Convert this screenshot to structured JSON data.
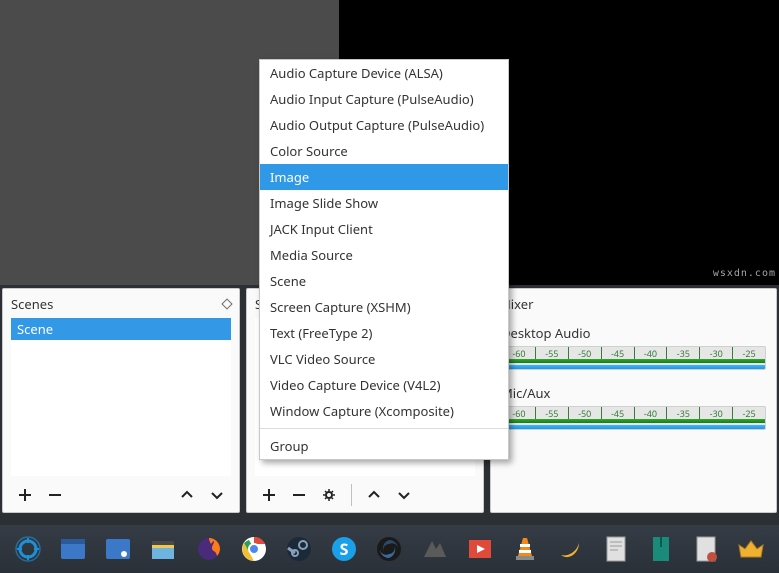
{
  "panels": {
    "scenes": {
      "title": "Scenes",
      "items": [
        "Scene"
      ]
    },
    "sources": {
      "title": "Sources"
    },
    "mixer": {
      "title": "Mixer",
      "tracks": [
        {
          "label": "Desktop Audio"
        },
        {
          "label": "Mic/Aux"
        }
      ],
      "ticks": [
        "-60",
        "-55",
        "-50",
        "-45",
        "-40",
        "-35",
        "-30",
        "-25"
      ]
    }
  },
  "context_menu": {
    "items": [
      "Audio Capture Device (ALSA)",
      "Audio Input Capture (PulseAudio)",
      "Audio Output Capture (PulseAudio)",
      "Color Source",
      "Image",
      "Image Slide Show",
      "JACK Input Client",
      "Media Source",
      "Scene",
      "Screen Capture (XSHM)",
      "Text (FreeType 2)",
      "VLC Video Source",
      "Video Capture Device (V4L2)",
      "Window Capture (Xcomposite)"
    ],
    "selected_index": 4,
    "group_label": "Group"
  },
  "watermark": "wsxdn.com",
  "taskbar": {
    "items": [
      {
        "name": "app-launcher-icon",
        "color": "#1e90d8"
      },
      {
        "name": "show-desktop-icon",
        "color": "#3c78c8"
      },
      {
        "name": "screenshot-icon",
        "color": "#3c78c8"
      },
      {
        "name": "file-manager-icon",
        "color": "#6fb3e0"
      },
      {
        "name": "firefox-icon",
        "color": "#ff7a1a"
      },
      {
        "name": "chrome-icon",
        "color": "#ffffff"
      },
      {
        "name": "steam-icon",
        "color": "#8aa0b4"
      },
      {
        "name": "skype-icon",
        "color": "#1aa0e8"
      },
      {
        "name": "obs-icon",
        "color": "#2a4a68"
      },
      {
        "name": "amarok-icon",
        "color": "#5a5a5a"
      },
      {
        "name": "media-app-icon",
        "color": "#e04a3a"
      },
      {
        "name": "vlc-icon",
        "color": "#f08a1a"
      },
      {
        "name": "banana-icon",
        "color": "#f0b030"
      },
      {
        "name": "document-icon",
        "color": "#e0e0e0"
      },
      {
        "name": "book-icon",
        "color": "#1a8a7a"
      },
      {
        "name": "notes-icon",
        "color": "#c05040"
      },
      {
        "name": "crown-icon",
        "color": "#f0b030"
      }
    ]
  }
}
